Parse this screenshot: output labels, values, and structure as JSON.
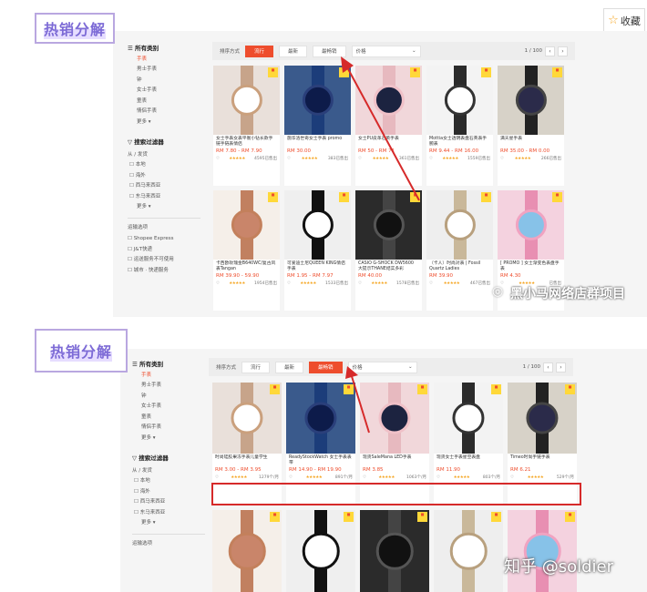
{
  "favorite": {
    "label": "收藏"
  },
  "top": {
    "title": "热销分解",
    "sidebar": {
      "all": "所有类别",
      "items": [
        "手表",
        "男士手表",
        "钟",
        "女士手表",
        "童表",
        "情侣手表",
        "更多"
      ],
      "filter": "搜索过滤器",
      "filter_sub": "从 / 发货",
      "filter_items": [
        "本地",
        "海外",
        "西马来西亚",
        "东马来西亚",
        "更多"
      ],
      "ship_hd": "运输选项",
      "ship_items": [
        "Shopee Express",
        "J&T快递",
        "运送服务不可使用",
        "城市 · 快递服务"
      ]
    },
    "toolbar": {
      "sort_label": "排序方式",
      "tabs": [
        "流行",
        "最新",
        "最畅销"
      ],
      "active": 0,
      "price": "价格",
      "page": "1 / 100"
    },
    "cards": [
      {
        "title": "女士手表女表平衡小钻长款手链手链表情侣",
        "price": "RM 7.80 - RM 7.90",
        "sold": "4595已售出"
      },
      {
        "title": "施华洛世奇女士手表 promo",
        "price": "RM 30.00",
        "sold": "383已售出"
      },
      {
        "title": "女士PU皮革石英手表",
        "price": "RM 50 - RM 71",
        "sold": "361已售出"
      },
      {
        "title": "Mottia女士透明表盘石英表手腕表",
        "price": "RM 9.44 - RM 16.00",
        "sold": "1559已售出"
      },
      {
        "title": "满天星手表",
        "price": "RM 35.00 - RM 0.00",
        "sold": "266已售出"
      },
      {
        "title": "卡西欧玫瑰金B640WC/复古风表Tangan",
        "price": "RM 39.90 - 59.90",
        "sold": "1954已售出"
      },
      {
        "title": "可爱迪士尼QUEEN KING情侣手表",
        "price": "RM 1.95 - RM 7.97",
        "sold": "1533已售出"
      },
      {
        "title": "CASIO G-SHOCK DW5600 大提示THANE结实多彩",
        "price": "RM 40.00",
        "sold": "1578已售出"
      },
      {
        "title": "（卡人）时尚对表 | Fossil Quartz Ladies",
        "price": "RM 39.90",
        "sold": "467已售出"
      },
      {
        "title": "[ PROMO ] 女士渐变色表盘手表",
        "price": "RM 4.30",
        "sold": "已售出"
      }
    ]
  },
  "bottom": {
    "title": "热销分解",
    "sidebar": {
      "all": "所有类别",
      "items": [
        "手表",
        "男士手表",
        "钟",
        "女士手表",
        "童表",
        "情侣手表",
        "更多"
      ],
      "filter": "搜索过滤器",
      "filter_sub": "从 / 发货",
      "filter_items": [
        "本地",
        "海外",
        "西马来西亚",
        "东马来西亚",
        "更多"
      ],
      "ship_hd": "运输选项"
    },
    "toolbar": {
      "sort_label": "排序方式",
      "tabs": [
        "流行",
        "最新",
        "最畅销"
      ],
      "active": 2,
      "price": "价格",
      "page": "1 / 100"
    },
    "cards": [
      {
        "title": "时尚硅胶果冻手表儿童学生",
        "price": "RM 3.00 - RM 3.95",
        "sold": "1279个/月"
      },
      {
        "title": "ReadyStockWatch 女士手表表带",
        "price": "RM 14.90 - RM 19.90",
        "sold": "891个/月"
      },
      {
        "title": "现货SaleMana LED手表",
        "price": "RM 3.85",
        "sold": "1063个/月"
      },
      {
        "title": "现货女士手表星空表盘",
        "price": "RM 11.90",
        "sold": "803个/月"
      },
      {
        "title": "Timeo时尚手链手表",
        "price": "RM 6.21",
        "sold": "529个/月"
      }
    ]
  },
  "watermark1": "黑小马网络店群项目",
  "watermark2": "知乎 @soldier"
}
